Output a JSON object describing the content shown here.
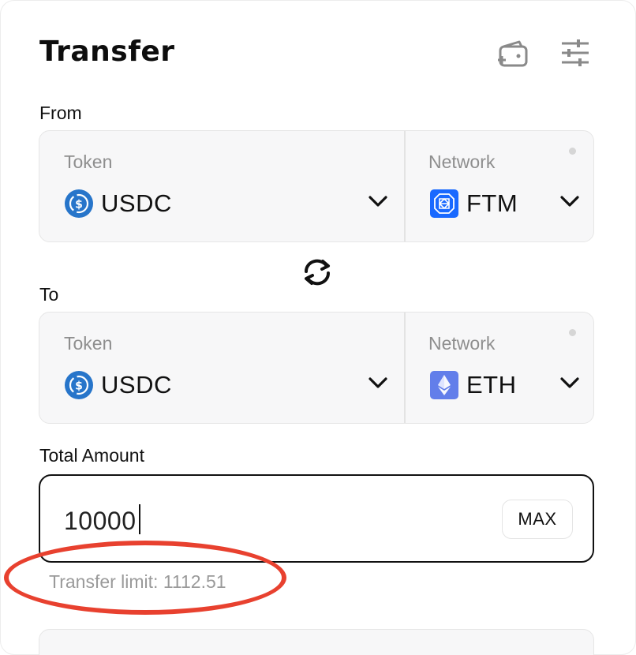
{
  "header": {
    "title": "Transfer",
    "wallet_icon": "wallet-add-icon",
    "settings_icon": "sliders-icon"
  },
  "from": {
    "label": "From",
    "token_label": "Token",
    "token_value": "USDC",
    "token_icon": "usdc-coin-icon",
    "network_label": "Network",
    "network_value": "FTM",
    "network_icon": "fantom-icon"
  },
  "swap_icon": "swap-arrows-icon",
  "to": {
    "label": "To",
    "token_label": "Token",
    "token_value": "USDC",
    "token_icon": "usdc-coin-icon",
    "network_label": "Network",
    "network_value": "ETH",
    "network_icon": "ethereum-icon"
  },
  "amount": {
    "label": "Total Amount",
    "value": "10000",
    "max_label": "MAX",
    "limit_text": "Transfer limit: 1112.51"
  },
  "colors": {
    "annotation": "#e8412f",
    "usdc": "#2775ca",
    "fantom": "#1969ff",
    "ethereum": "#627eea"
  }
}
